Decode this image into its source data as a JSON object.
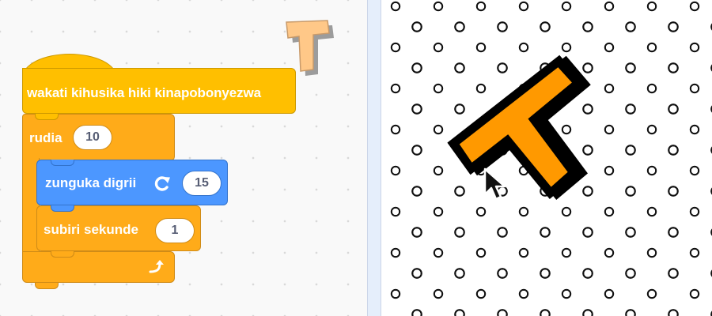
{
  "script": {
    "event_block": {
      "label": "wakati kihusika hiki kinapobonyezwa"
    },
    "repeat_block": {
      "label": "rudia",
      "count": "10"
    },
    "turn_block": {
      "label": "zunguka digrii",
      "icon": "rotate-right-icon",
      "degrees": "15"
    },
    "wait_block": {
      "label": "subiri sekunde",
      "seconds": "1"
    },
    "loop_icon": "loop-arrow-icon"
  },
  "sprite": {
    "letter": "T",
    "colors": {
      "fill": "#ff9900",
      "outline": "#000000",
      "thumb_fill": "#ffc888",
      "thumb_shadow": "#9c9c9c"
    }
  },
  "colors": {
    "events": "#ffbf00",
    "control": "#ffab19",
    "motion": "#4c97ff",
    "value_text": "#575e75"
  }
}
